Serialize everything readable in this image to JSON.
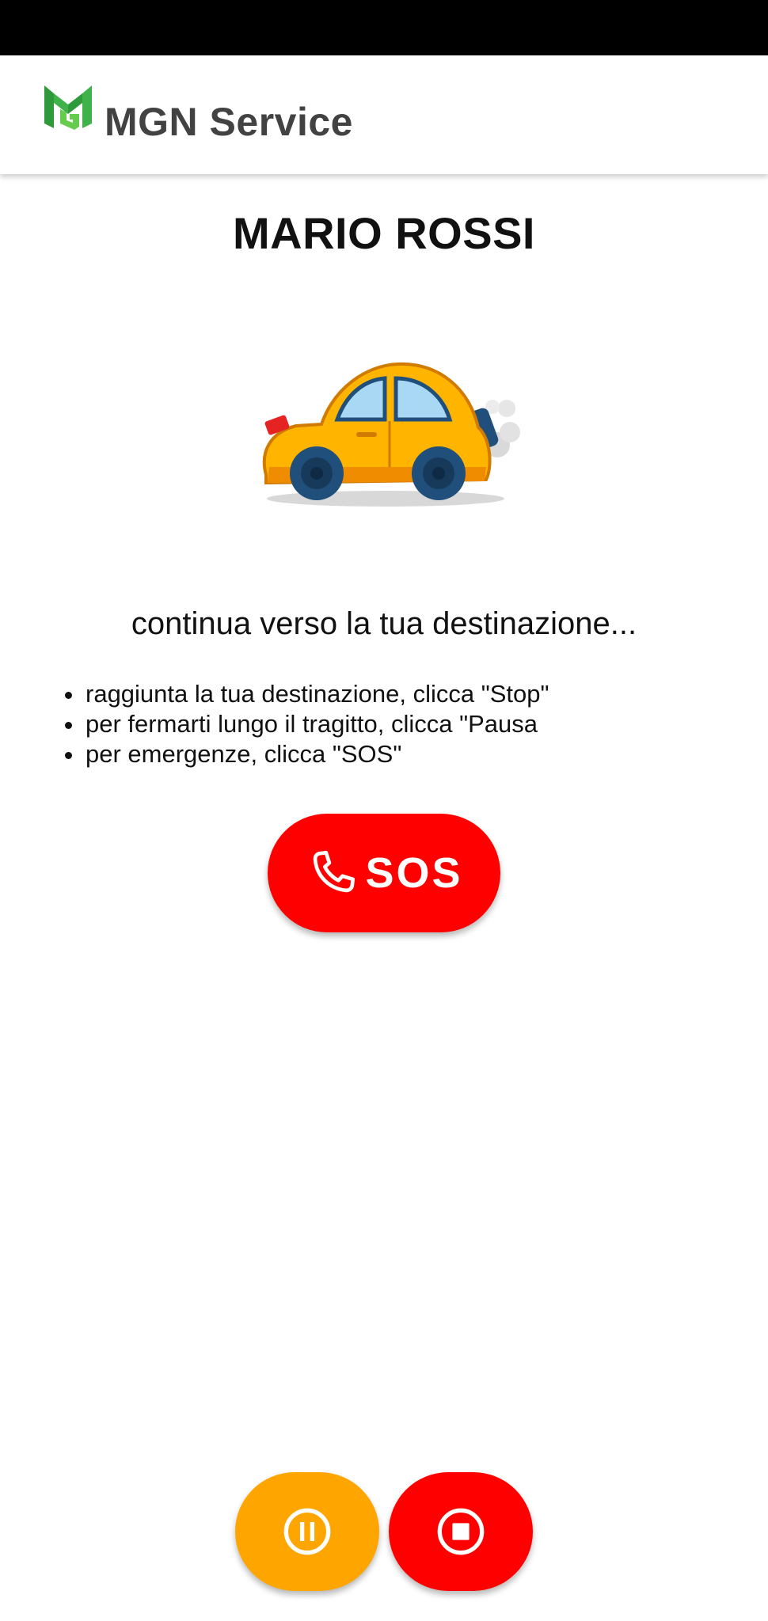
{
  "app": {
    "title": "MGN Service",
    "logo_icon": "mgn-logo-icon"
  },
  "user": {
    "name": "MARIO ROSSI"
  },
  "illustration": {
    "icon": "car-icon"
  },
  "status": {
    "message": "continua verso la tua destinazione..."
  },
  "instructions": [
    "raggiunta la tua destinazione, clicca \"Stop\"",
    "per fermarti lungo il tragitto, clicca \"Pausa",
    "per emergenze, clicca \"SOS\""
  ],
  "sos_button": {
    "label": "SOS",
    "icon": "phone-icon",
    "color": "#ff0000"
  },
  "controls": {
    "pause": {
      "icon": "pause-icon",
      "color": "#ffa500"
    },
    "stop": {
      "icon": "stop-icon",
      "color": "#ff0000"
    }
  },
  "colors": {
    "logo_green": "#3aa63a",
    "title_text": "#424242",
    "status_bar": "#000000"
  }
}
